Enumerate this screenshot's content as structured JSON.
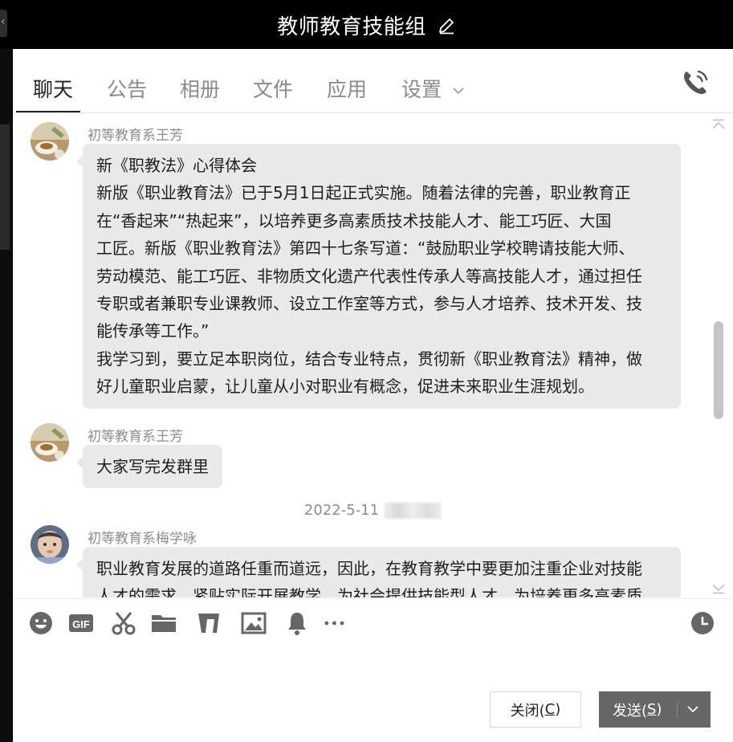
{
  "window": {
    "title": "教师教育技能组"
  },
  "tabs": [
    {
      "label": "聊天"
    },
    {
      "label": "公告"
    },
    {
      "label": "相册"
    },
    {
      "label": "文件"
    },
    {
      "label": "应用"
    },
    {
      "label": "设置"
    }
  ],
  "messages": [
    {
      "sender": "初等教育系王芳",
      "lines": [
        "新《职教法》心得体会",
        "新版《职业教育法》已于5月1日起正式实施。随着法律的完善，职业教育正",
        "在“香起来”“热起来”，以培养更多高素质技术技能人才、能工巧匠、大国",
        "工匠。新版《职业教育法》第四十七条写道：“鼓励职业学校聘请技能大师、",
        "劳动模范、能工巧匠、非物质文化遗产代表性传承人等高技能人才，通过担任",
        "专职或者兼职专业课教师、设立工作室等方式，参与人才培养、技术开发、技",
        "能传承等工作。”",
        "我学习到，要立足本职岗位，结合专业特点，贯彻新《职业教育法》精神，做",
        "好儿童职业启蒙，让儿童从小对职业有概念，促进未来职业生涯规划。"
      ]
    },
    {
      "sender": "初等教育系王芳",
      "lines": [
        "大家写完发群里"
      ]
    },
    {
      "sender": "初等教育系梅学咏",
      "lines": [
        "职业教育发展的道路任重而道远，因此，在教育教学中要更加注重企业对技能",
        "人才的需求，紧贴实际开展教学，为社会提供技能型人才，为培养更多高素质"
      ]
    }
  ],
  "timestamp": "2022-5-11",
  "toolbar": {
    "icons": [
      "emoji-icon",
      "gif-icon",
      "scissors-icon",
      "folder-icon",
      "music-icon",
      "image-icon",
      "bell-icon",
      "more-icon",
      "history-icon"
    ]
  },
  "buttons": {
    "close_label": "关闭(",
    "close_key": "C",
    "close_suffix": ")",
    "send_label": "发送(",
    "send_key": "S",
    "send_suffix": ")"
  },
  "colors": {
    "titlebar": "#000000",
    "bubble": "#e9e9e9",
    "send_button": "#666666"
  }
}
